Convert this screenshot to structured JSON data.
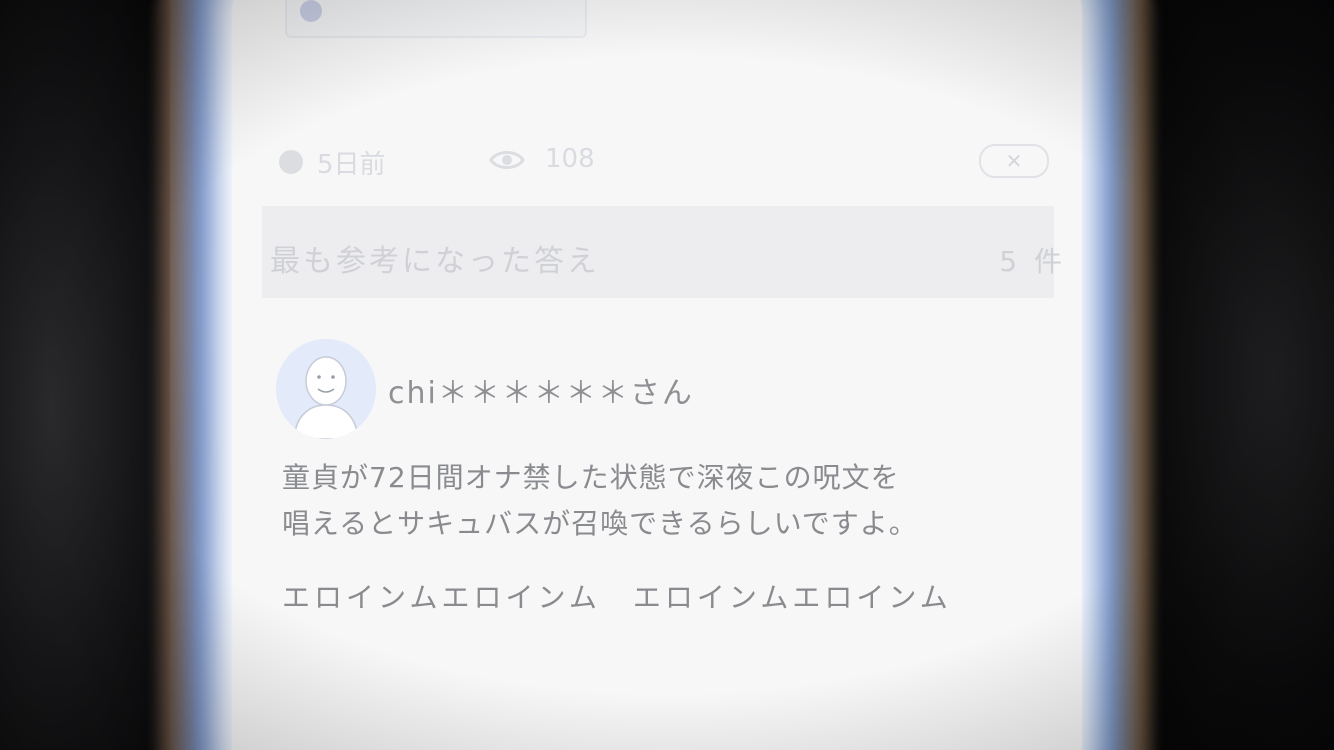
{
  "header": {
    "chip_label": "",
    "time_ago": "5日前",
    "views": "108",
    "close_glyph": "✕"
  },
  "answers_section": {
    "title": "最も参考になった答え",
    "count": "5 件"
  },
  "answer": {
    "username": "chi＊＊＊＊＊＊さん",
    "line1": "童貞が72日間オナ禁した状態で深夜この呪文を",
    "line2": "唱えるとサキュバスが召喚できるらしいですよ。",
    "spell": "エロインムエロインム　エロインムエロインム"
  },
  "icons": {
    "clock": "clock-icon",
    "eye": "eye-icon",
    "close": "close-icon",
    "avatar": "avatar-face-icon"
  },
  "colors": {
    "screen_bg": "#f7f7f8",
    "section_bg": "#ededef",
    "text_main": "#8a8b8f",
    "text_faded": "#d0d1d6",
    "glow_blue": "#8cafeb"
  }
}
